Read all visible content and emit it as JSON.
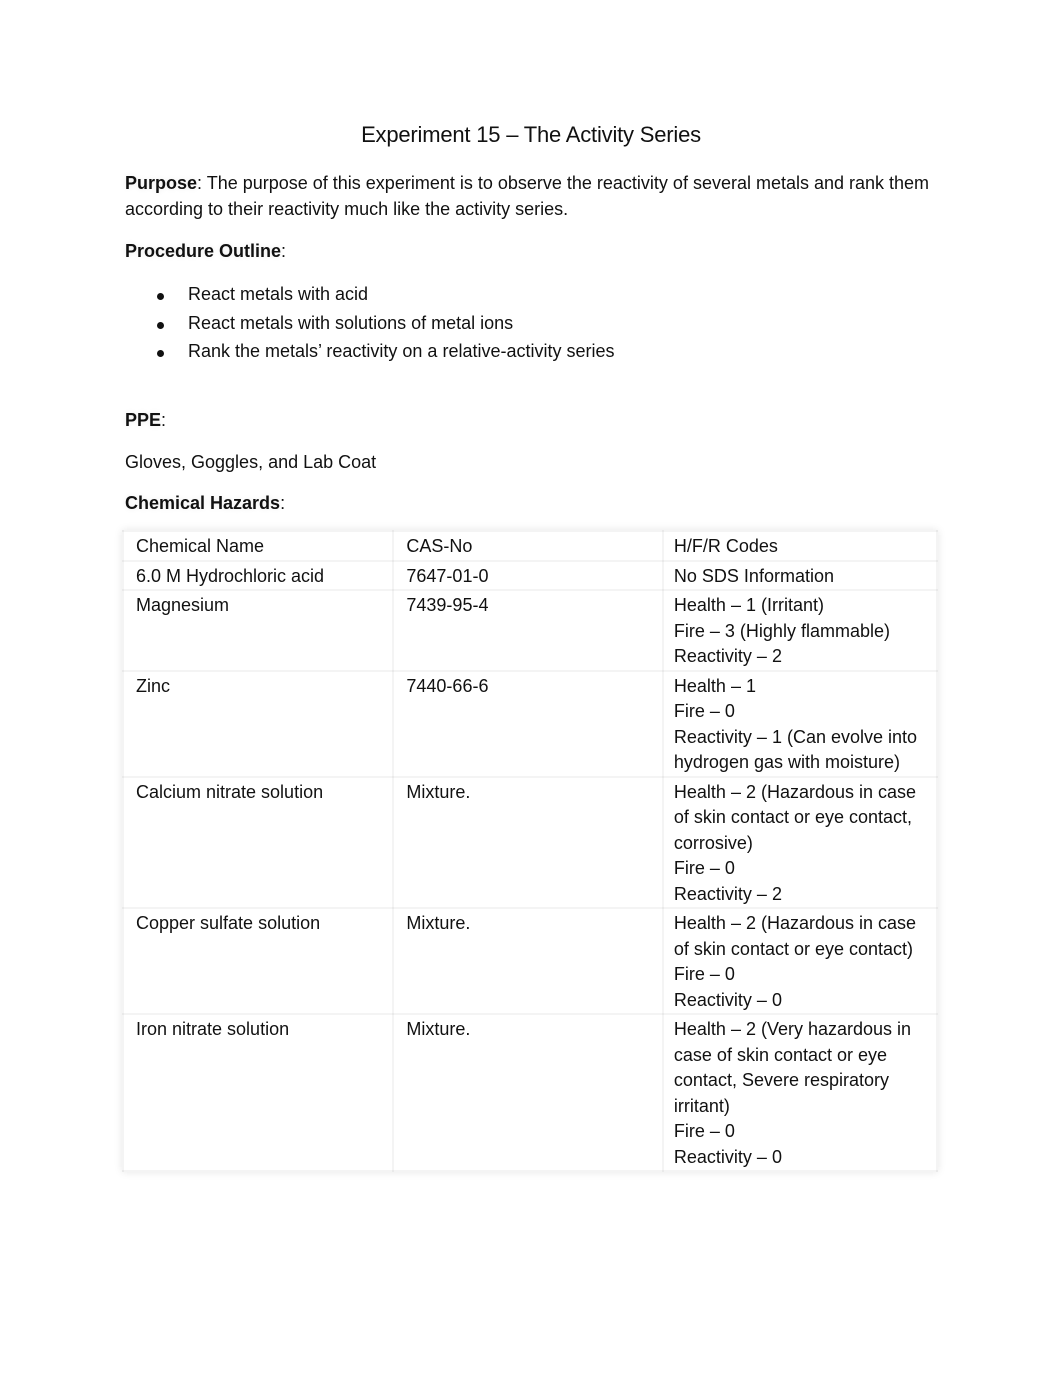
{
  "document": {
    "title": "Experiment 15 – The Activity Series",
    "purpose": {
      "label": "Purpose",
      "text": ": The purpose of this experiment is to observe the reactivity of several metals and rank them according to their reactivity much like the activity series."
    },
    "procedure": {
      "label": "Procedure Outline",
      "suffix": ":",
      "items": [
        "React metals with acid",
        "React metals with solutions of metal ions",
        "Rank the metals’ reactivity on a relative-activity series"
      ]
    },
    "ppe": {
      "label": "PPE",
      "suffix": ":",
      "value": "Gloves, Goggles, and Lab Coat"
    },
    "hazards": {
      "label": "Chemical Hazards",
      "suffix": ":",
      "columns": [
        "Chemical Name",
        "CAS-No",
        "H/F/R Codes"
      ],
      "rows": [
        {
          "name": "6.0 M Hydrochloric acid",
          "cas": "7647-01-0",
          "codes": [
            "No SDS Information"
          ]
        },
        {
          "name": "Magnesium",
          "cas": "7439-95-4",
          "codes": [
            "Health – 1 (Irritant)",
            "Fire – 3 (Highly flammable)",
            "Reactivity – 2"
          ]
        },
        {
          "name": "Zinc",
          "cas": "7440-66-6",
          "codes": [
            "Health – 1",
            "Fire – 0",
            "Reactivity – 1 (Can evolve into hydrogen gas with moisture)"
          ]
        },
        {
          "name": "Calcium nitrate solution",
          "cas": "Mixture.",
          "codes": [
            "Health – 2 (Hazardous in case of skin contact or eye contact, corrosive)",
            "Fire – 0",
            "Reactivity – 2"
          ]
        },
        {
          "name": "Copper sulfate solution",
          "cas": "Mixture.",
          "codes": [
            "Health – 2 (Hazardous in case of skin contact or eye contact)",
            "Fire – 0",
            "Reactivity – 0"
          ]
        },
        {
          "name": "Iron nitrate solution",
          "cas": "Mixture.",
          "codes": [
            "Health – 2 (Very hazardous in case of skin contact or eye contact, Severe respiratory irritant)",
            "Fire – 0",
            "Reactivity – 0"
          ]
        }
      ]
    }
  }
}
